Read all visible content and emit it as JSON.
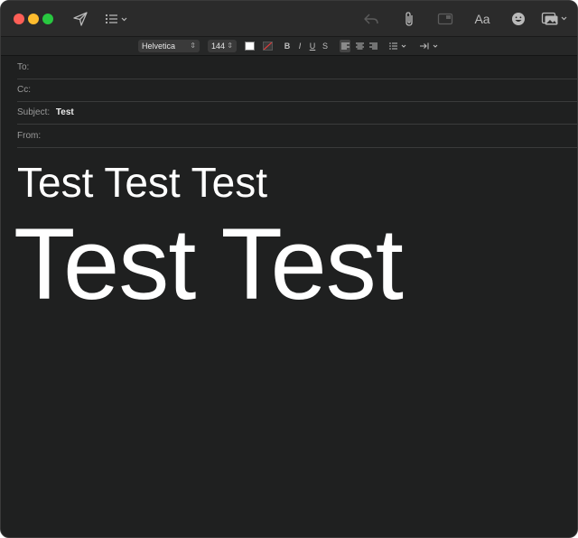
{
  "toolbar": {
    "font_label": "Aa",
    "icons": [
      "send-icon",
      "header-fields-icon",
      "reply-icon",
      "attachment-icon",
      "markup-icon",
      "format-icon",
      "emoji-icon",
      "photo-browser-icon"
    ]
  },
  "format_bar": {
    "font_family": "Helvetica",
    "font_size": "144",
    "bold": "B",
    "italic": "I",
    "underline": "U",
    "strike": "S"
  },
  "headers": {
    "to_label": "To:",
    "to_value": "",
    "cc_label": "Cc:",
    "cc_value": "",
    "subject_label": "Subject:",
    "subject_value": "Test",
    "from_label": "From:",
    "from_value": ""
  },
  "body": {
    "line1": "Test Test Test",
    "line2": "Test Test"
  },
  "colors": {
    "window_bg": "#1f2020",
    "close": "#fe5f57",
    "minimize": "#febc2e",
    "maximize": "#28c840"
  }
}
